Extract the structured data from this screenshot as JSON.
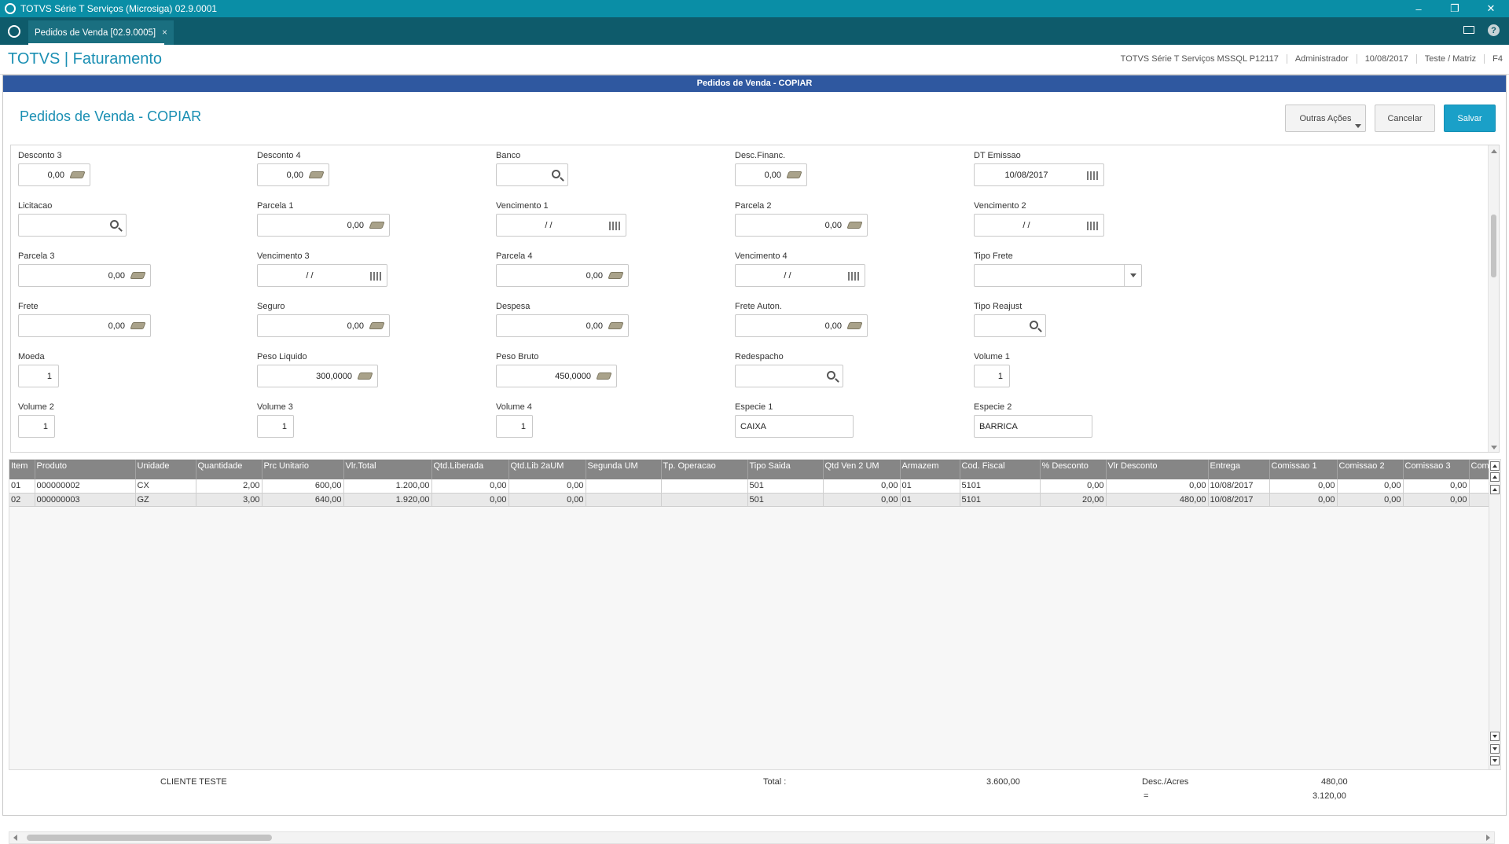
{
  "window": {
    "title": "TOTVS Série T Serviços (Microsiga) 02.9.0001",
    "minimize": "–",
    "restore": "❐",
    "close": "✕"
  },
  "tabbar": {
    "tab_label": "Pedidos de Venda [02.9.0005]",
    "tab_close": "×",
    "help": "?"
  },
  "header": {
    "brand": "TOTVS | Faturamento",
    "environment": "TOTVS Série T Serviços MSSQL P12117",
    "user": "Administrador",
    "date": "10/08/2017",
    "company": "Teste / Matriz",
    "shortcut": "F4"
  },
  "screen": {
    "window_title": "Pedidos de Venda - COPIAR",
    "page_title": "Pedidos de Venda - COPIAR",
    "btn_outras": "Outras Ações",
    "btn_cancelar": "Cancelar",
    "btn_salvar": "Salvar"
  },
  "form": {
    "desconto3": {
      "label": "Desconto 3",
      "value": "0,00"
    },
    "desconto4": {
      "label": "Desconto 4",
      "value": "0,00"
    },
    "banco": {
      "label": "Banco",
      "value": ""
    },
    "desc_financ": {
      "label": "Desc.Financ.",
      "value": "0,00"
    },
    "dt_emissao": {
      "label": "DT Emissao",
      "value": "10/08/2017"
    },
    "licitacao": {
      "label": "Licitacao",
      "value": ""
    },
    "parcela1": {
      "label": "Parcela 1",
      "value": "0,00"
    },
    "vencimento1": {
      "label": "Vencimento 1",
      "value": "/ /"
    },
    "parcela2": {
      "label": "Parcela 2",
      "value": "0,00"
    },
    "vencimento2": {
      "label": "Vencimento 2",
      "value": "/ /"
    },
    "parcela3": {
      "label": "Parcela 3",
      "value": "0,00"
    },
    "vencimento3": {
      "label": "Vencimento 3",
      "value": "/ /"
    },
    "parcela4": {
      "label": "Parcela 4",
      "value": "0,00"
    },
    "vencimento4": {
      "label": "Vencimento 4",
      "value": "/ /"
    },
    "tipo_frete": {
      "label": "Tipo Frete",
      "value": ""
    },
    "frete": {
      "label": "Frete",
      "value": "0,00"
    },
    "seguro": {
      "label": "Seguro",
      "value": "0,00"
    },
    "despesa": {
      "label": "Despesa",
      "value": "0,00"
    },
    "frete_auton": {
      "label": "Frete Auton.",
      "value": "0,00"
    },
    "tipo_reajust": {
      "label": "Tipo Reajust",
      "value": ""
    },
    "moeda": {
      "label": "Moeda",
      "value": "1"
    },
    "peso_liquido": {
      "label": "Peso Liquido",
      "value": "300,0000"
    },
    "peso_bruto": {
      "label": "Peso Bruto",
      "value": "450,0000"
    },
    "redespacho": {
      "label": "Redespacho",
      "value": ""
    },
    "volume1": {
      "label": "Volume 1",
      "value": "1"
    },
    "volume2": {
      "label": "Volume 2",
      "value": "1"
    },
    "volume3": {
      "label": "Volume 3",
      "value": "1"
    },
    "volume4": {
      "label": "Volume 4",
      "value": "1"
    },
    "especie1": {
      "label": "Especie 1",
      "value": "CAIXA"
    },
    "especie2": {
      "label": "Especie 2",
      "value": "BARRICA"
    }
  },
  "grid": {
    "columns": [
      "Item",
      "Produto",
      "Unidade",
      "Quantidade",
      "Prc Unitario",
      "Vlr.Total",
      "Qtd.Liberada",
      "Qtd.Lib 2aUM",
      "Segunda UM",
      "Tp. Operacao",
      "Tipo Saida",
      "Qtd Ven 2 UM",
      "Armazem",
      "Cod. Fiscal",
      "% Desconto",
      "Vlr Desconto",
      "Entrega",
      "Comissao 1",
      "Comissao 2",
      "Comissao 3",
      "Com"
    ],
    "rows": [
      [
        "01",
        "000000002",
        "CX",
        "2,00",
        "600,00",
        "1.200,00",
        "0,00",
        "0,00",
        "",
        "",
        "501",
        "0,00",
        "01",
        "5101",
        "0,00",
        "0,00",
        "10/08/2017",
        "0,00",
        "0,00",
        "0,00",
        ""
      ],
      [
        "02",
        "000000003",
        "GZ",
        "3,00",
        "640,00",
        "1.920,00",
        "0,00",
        "0,00",
        "",
        "",
        "501",
        "0,00",
        "01",
        "5101",
        "20,00",
        "480,00",
        "10/08/2017",
        "0,00",
        "0,00",
        "0,00",
        ""
      ]
    ]
  },
  "footer": {
    "cliente": "CLIENTE TESTE",
    "total_label": "Total :",
    "total_value": "3.600,00",
    "desc_label": "Desc./Acres",
    "desc_value": "480,00",
    "net_label": "=",
    "net_value": "3.120,00"
  }
}
